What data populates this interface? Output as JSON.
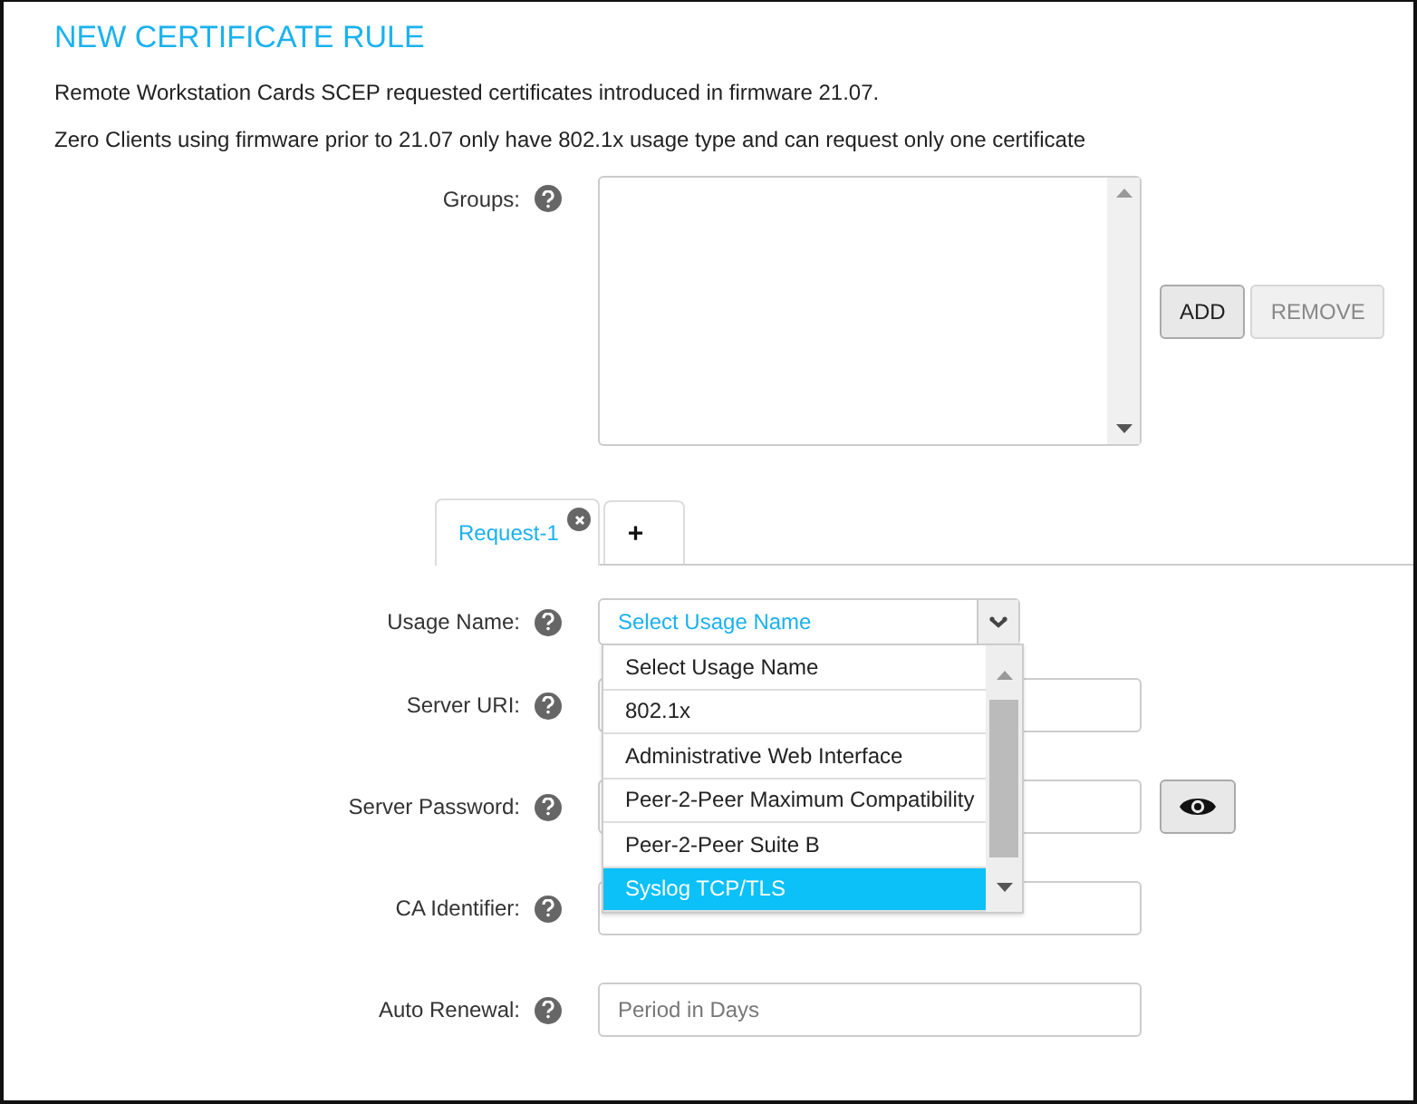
{
  "title": "NEW CERTIFICATE RULE",
  "notes": [
    "Remote Workstation Cards SCEP requested certificates introduced in firmware 21.07.",
    "Zero Clients using firmware prior to 21.07 only have 802.1x usage type and can request only one certificate"
  ],
  "groups": {
    "label": "Groups:",
    "buttons": [
      {
        "label": "ADD",
        "disabled": false
      },
      {
        "label": "REMOVE",
        "disabled": true
      }
    ]
  },
  "tabs": [
    {
      "label": "Request-1",
      "selected": true,
      "closable": true
    },
    {
      "label": "+",
      "selected": false,
      "closable": false
    }
  ],
  "fields": [
    {
      "kind": "select",
      "label": "Usage Name:",
      "value": "Select Usage Name",
      "expanded": true,
      "options": [
        {
          "label": "Select Usage Name",
          "highlighted": false
        },
        {
          "label": "802.1x",
          "highlighted": false
        },
        {
          "label": "Administrative Web Interface",
          "highlighted": false
        },
        {
          "label": "Peer-2-Peer Maximum Compatibility",
          "highlighted": false
        },
        {
          "label": "Peer-2-Peer Suite B",
          "highlighted": false
        },
        {
          "label": "Syslog TCP/TLS",
          "highlighted": true
        }
      ]
    },
    {
      "kind": "text",
      "label": "Server URI:"
    },
    {
      "kind": "password",
      "label": "Server Password:"
    },
    {
      "kind": "text",
      "label": "CA Identifier:"
    },
    {
      "kind": "text",
      "label": "Auto Renewal:",
      "placeholder": "Period in Days"
    }
  ]
}
